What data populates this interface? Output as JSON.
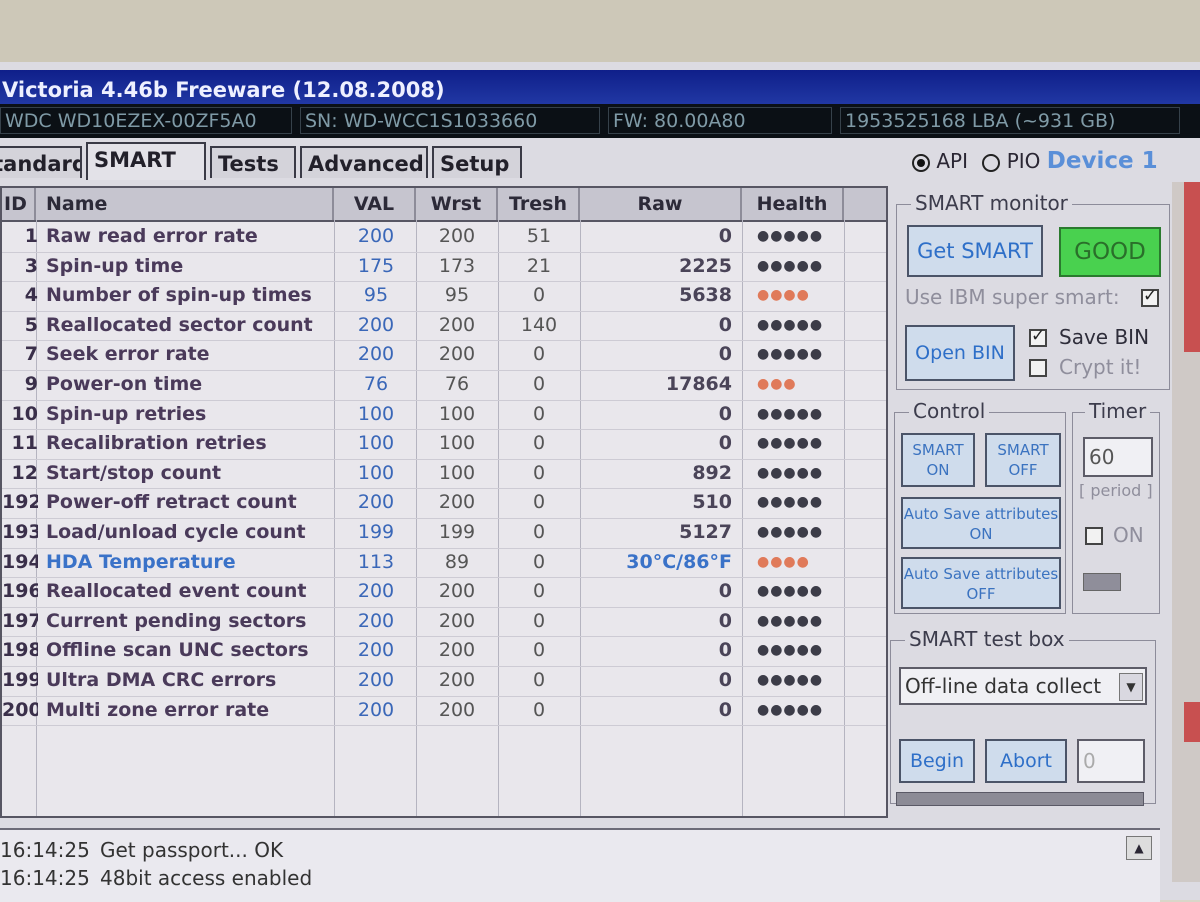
{
  "window": {
    "title": "Victoria 4.46b Freeware (12.08.2008)"
  },
  "device_info": {
    "model": "WDC WD10EZEX-00ZF5A0",
    "serial": "SN: WD-WCC1S1033660",
    "firmware": "FW: 80.00A80",
    "capacity": "1953525168 LBA (~931 GB)"
  },
  "tabs": [
    {
      "label": "Standard"
    },
    {
      "label": "SMART",
      "active": true
    },
    {
      "label": "Tests"
    },
    {
      "label": "Advanced"
    },
    {
      "label": "Setup"
    }
  ],
  "mode": {
    "api": "API",
    "pio": "PIO",
    "device": "Device 1"
  },
  "table": {
    "columns": [
      "ID",
      "Name",
      "VAL",
      "Wrst",
      "Tresh",
      "Raw",
      "Health"
    ],
    "rows": [
      {
        "id": "1",
        "name": "Raw read error rate",
        "val": "200",
        "wrst": "200",
        "tresh": "51",
        "raw": "0",
        "health": "●●●●●"
      },
      {
        "id": "3",
        "name": "Spin-up time",
        "val": "175",
        "wrst": "173",
        "tresh": "21",
        "raw": "2225",
        "health": "●●●●●"
      },
      {
        "id": "4",
        "name": "Number of spin-up times",
        "val": "95",
        "wrst": "95",
        "tresh": "0",
        "raw": "5638",
        "health": "●●●●"
      },
      {
        "id": "5",
        "name": "Reallocated sector count",
        "val": "200",
        "wrst": "200",
        "tresh": "140",
        "raw": "0",
        "health": "●●●●●"
      },
      {
        "id": "7",
        "name": "Seek error rate",
        "val": "200",
        "wrst": "200",
        "tresh": "0",
        "raw": "0",
        "health": "●●●●●"
      },
      {
        "id": "9",
        "name": "Power-on time",
        "val": "76",
        "wrst": "76",
        "tresh": "0",
        "raw": "17864",
        "health": "●●●"
      },
      {
        "id": "10",
        "name": "Spin-up retries",
        "val": "100",
        "wrst": "100",
        "tresh": "0",
        "raw": "0",
        "health": "●●●●●"
      },
      {
        "id": "11",
        "name": "Recalibration retries",
        "val": "100",
        "wrst": "100",
        "tresh": "0",
        "raw": "0",
        "health": "●●●●●"
      },
      {
        "id": "12",
        "name": "Start/stop count",
        "val": "100",
        "wrst": "100",
        "tresh": "0",
        "raw": "892",
        "health": "●●●●●"
      },
      {
        "id": "192",
        "name": "Power-off retract count",
        "val": "200",
        "wrst": "200",
        "tresh": "0",
        "raw": "510",
        "health": "●●●●●"
      },
      {
        "id": "193",
        "name": "Load/unload cycle count",
        "val": "199",
        "wrst": "199",
        "tresh": "0",
        "raw": "5127",
        "health": "●●●●●"
      },
      {
        "id": "194",
        "name": "HDA Temperature",
        "val": "113",
        "wrst": "89",
        "tresh": "0",
        "raw": "30°C/86°F",
        "health": "●●●●",
        "highlight": true
      },
      {
        "id": "196",
        "name": "Reallocated event count",
        "val": "200",
        "wrst": "200",
        "tresh": "0",
        "raw": "0",
        "health": "●●●●●"
      },
      {
        "id": "197",
        "name": "Current pending sectors",
        "val": "200",
        "wrst": "200",
        "tresh": "0",
        "raw": "0",
        "health": "●●●●●"
      },
      {
        "id": "198",
        "name": "Offline scan UNC sectors",
        "val": "200",
        "wrst": "200",
        "tresh": "0",
        "raw": "0",
        "health": "●●●●●"
      },
      {
        "id": "199",
        "name": "Ultra DMA CRC errors",
        "val": "200",
        "wrst": "200",
        "tresh": "0",
        "raw": "0",
        "health": "●●●●●"
      },
      {
        "id": "200",
        "name": "Multi zone error rate",
        "val": "200",
        "wrst": "200",
        "tresh": "0",
        "raw": "0",
        "health": "●●●●●"
      }
    ]
  },
  "smart_monitor": {
    "title": "SMART monitor",
    "get_smart": "Get SMART",
    "status": "GOOD",
    "use_ibm": "Use IBM super smart:",
    "open_bin": "Open BIN",
    "save_bin": "Save BIN",
    "crypt": "Crypt it!"
  },
  "control": {
    "title": "Control",
    "smart_on": "SMART ON",
    "smart_off": "SMART OFF",
    "autosave_on": "Auto Save attributes ON",
    "autosave_off": "Auto Save attributes OFF"
  },
  "timer": {
    "title": "Timer",
    "value": "60",
    "period": "[ period ]",
    "on": "ON"
  },
  "test_box": {
    "title": "SMART test box",
    "selected": "Off-line data collect",
    "begin": "Begin",
    "abort": "Abort",
    "count": "0"
  },
  "log": [
    {
      "time": "16:14:25",
      "msg": "Get passport... OK"
    },
    {
      "time": "16:14:25",
      "msg": "48bit access enabled"
    }
  ],
  "colors": {
    "title_bar": "#1b2f9a",
    "good": "#49d14f",
    "accent": "#2e6fc8",
    "health_warn": "#e07a5a"
  }
}
